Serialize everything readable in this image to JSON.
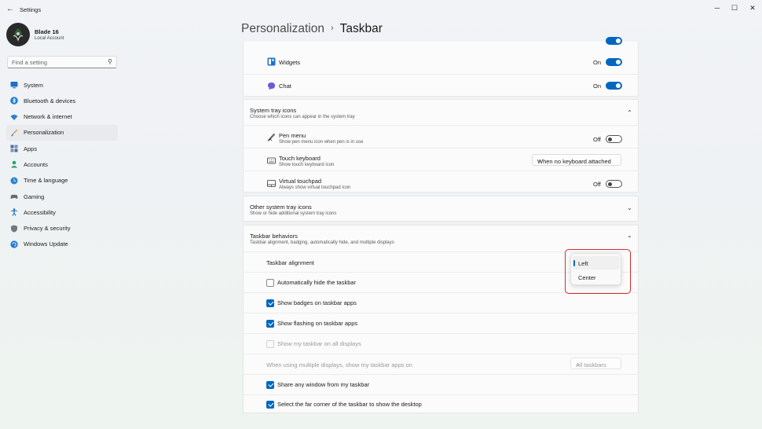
{
  "window": {
    "back_glyph": "←",
    "app_title": "Settings",
    "min_glyph": "─",
    "max_glyph": "☐",
    "close_glyph": "✕"
  },
  "profile": {
    "name": "Blade 16",
    "account": "Local Account"
  },
  "search": {
    "placeholder": "Find a setting",
    "icon": "search-icon"
  },
  "nav": [
    {
      "label": "System",
      "icon": "system-icon",
      "color": "#1f6fc4"
    },
    {
      "label": "Bluetooth & devices",
      "icon": "bluetooth-icon",
      "color": "#1f7fd6"
    },
    {
      "label": "Network & internet",
      "icon": "wifi-icon",
      "color": "#2a7fcf"
    },
    {
      "label": "Personalization",
      "icon": "brush-icon",
      "color": "#e08a2c",
      "active": true
    },
    {
      "label": "Apps",
      "icon": "apps-icon",
      "color": "#4a6fa5"
    },
    {
      "label": "Accounts",
      "icon": "person-icon",
      "color": "#2aa06a"
    },
    {
      "label": "Time & language",
      "icon": "globe-clock-icon",
      "color": "#2a85d0"
    },
    {
      "label": "Gaming",
      "icon": "gamepad-icon",
      "color": "#6a6a6a"
    },
    {
      "label": "Accessibility",
      "icon": "accessibility-icon",
      "color": "#1a6fc0"
    },
    {
      "label": "Privacy & security",
      "icon": "shield-icon",
      "color": "#707880"
    },
    {
      "label": "Windows Update",
      "icon": "update-icon",
      "color": "#1f78d1"
    }
  ],
  "breadcrumb": {
    "parent": "Personalization",
    "separator": "›",
    "current": "Taskbar"
  },
  "taskbar_items": [
    {
      "label": "Widgets",
      "icon": "widgets-icon",
      "status": "On"
    },
    {
      "label": "Chat",
      "icon": "chat-icon",
      "status": "On"
    }
  ],
  "system_tray": {
    "title": "System tray icons",
    "subtitle": "Choose which icons can appear in the system tray",
    "chevron": "⌃",
    "items": [
      {
        "label": "Pen menu",
        "sub": "Show pen menu icon when pen is in use",
        "icon": "pen-icon",
        "status": "Off"
      },
      {
        "label": "Touch keyboard",
        "sub": "Show touch keyboard icon",
        "icon": "keyboard-icon",
        "dropdown": "When no keyboard attached"
      },
      {
        "label": "Virtual touchpad",
        "sub": "Always show virtual touchpad icon",
        "icon": "touchpad-icon",
        "status": "Off"
      }
    ]
  },
  "other_tray": {
    "title": "Other system tray icons",
    "subtitle": "Show or hide additional system tray icons",
    "chevron": "⌄"
  },
  "behaviors": {
    "title": "Taskbar behaviors",
    "subtitle": "Taskbar alignment, badging, automatically hide, and multiple displays",
    "chevron": "⌃",
    "alignment_label": "Taskbar alignment",
    "auto_hide": "Automatically hide the taskbar",
    "badges": "Show badges on taskbar apps",
    "flashing": "Show flashing on taskbar apps",
    "all_displays": "Show my taskbar on all displays",
    "multi_display_label": "When using multiple displays, show my taskbar apps on",
    "multi_display_value": "All taskbars",
    "share_window": "Share any window from my taskbar",
    "far_corner": "Select the far corner of the taskbar to show the desktop"
  },
  "alignment_popup": {
    "options": [
      "Left",
      "Center"
    ],
    "selected": "Left"
  },
  "dropdown_chevron": "⌄",
  "colors": {
    "accent": "#0067c0",
    "highlight": "#d42b2b"
  }
}
